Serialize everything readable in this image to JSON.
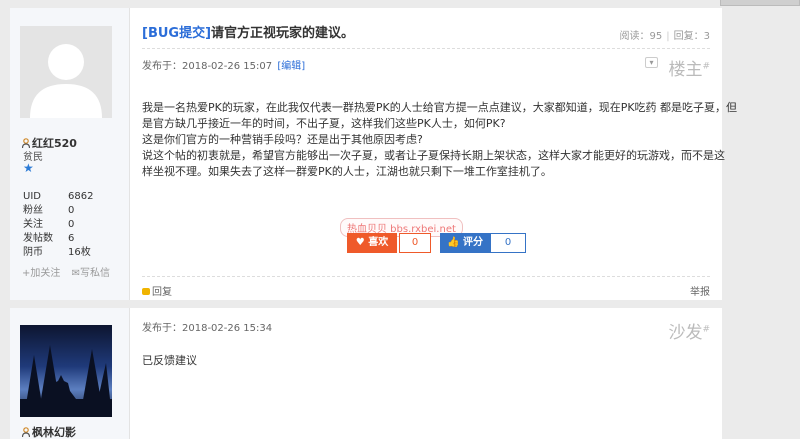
{
  "post1": {
    "title_tag": "[BUG提交]",
    "title_text": "请官方正视玩家的建议。",
    "views_label": "阅读：",
    "views": "95",
    "replies_label": "回复：",
    "replies": "3",
    "posted_label": "发布于：",
    "posted_time": "2018-02-26 15:07",
    "edit_label": "[编辑]",
    "floor_label": "楼主",
    "floor_mark": "#",
    "author": {
      "name": "红红520",
      "rank": "贫民",
      "stats": [
        {
          "label": "UID",
          "value": "6862"
        },
        {
          "label": "粉丝",
          "value": "0"
        },
        {
          "label": "关注",
          "value": "0"
        },
        {
          "label": "发帖数",
          "value": "6"
        },
        {
          "label": "阴币",
          "value": "16枚"
        }
      ],
      "add_follow": "+加关注",
      "write_letter": "写私信"
    },
    "content": [
      "我是一名热爱PK的玩家，在此我仅代表一群热爱PK的人士给官方提一点点建议，大家都知道，现在PK吃药 都是吃子夏，但",
      "是官方缺几乎接近一年的时间，不出子夏，这样我们这些PK人士，如何PK?",
      "这是你们官方的一种营销手段吗？还是出于其他原因考虑?",
      "说这个帖的初衷就是，希望官方能够出一次子夏，或者让子夏保持长期上架状态，这样大家才能更好的玩游戏，而不是这",
      "样坐视不理。如果失去了这样一群爱PK的人士，江湖也就只剩下一堆工作室挂机了。"
    ],
    "watermark": "热血贝贝 bbs.rxbei.net",
    "like_label": "喜欢",
    "like_count": "0",
    "rate_label": "评分",
    "rate_count": "0",
    "reply_label": "回复",
    "report_label": "举报"
  },
  "post2": {
    "posted_label": "发布于：",
    "posted_time": "2018-02-26 15:34",
    "floor_label": "沙发",
    "floor_mark": "#",
    "content": "已反馈建议",
    "author": {
      "name": "枫林幻影"
    }
  }
}
